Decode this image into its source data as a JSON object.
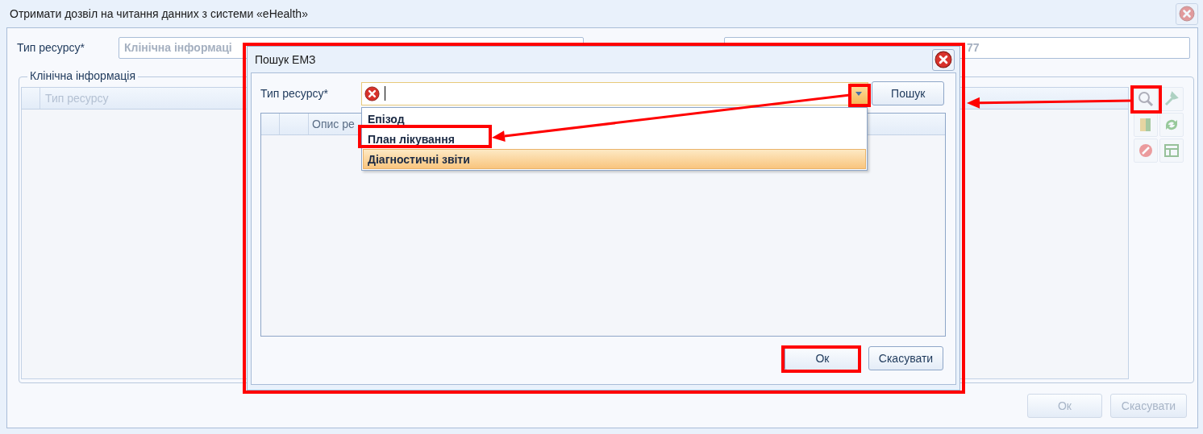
{
  "window": {
    "title": "Отримати дозвіл на читання данних з системи «eHealth»"
  },
  "resource_field": {
    "label": "Тип ресурсу*",
    "value": "Клінічна інформаці",
    "disabled": true
  },
  "second_field": {
    "value": "77",
    "disabled": true
  },
  "group": {
    "title": "Клінічна інформація",
    "columns": [
      "Тип ресурсу"
    ]
  },
  "buttons": [
    {
      "label": "Ок",
      "disabled": true
    },
    {
      "label": "Скасувати",
      "disabled": true
    }
  ],
  "dialog": {
    "title": "Пошук ЕМЗ",
    "field": {
      "label": "Тип ресурсу*",
      "error": true
    },
    "search_button": "Пошук",
    "columns": [
      "Опис ре"
    ],
    "options": [
      {
        "label": "Епізод",
        "selected": false
      },
      {
        "label": "План лікування",
        "selected": false
      },
      {
        "label": "Діагностичні звіти",
        "selected": true
      }
    ],
    "buttons": [
      {
        "label": "Ок",
        "disabled": false
      },
      {
        "label": "Скасувати",
        "disabled": false
      }
    ]
  }
}
